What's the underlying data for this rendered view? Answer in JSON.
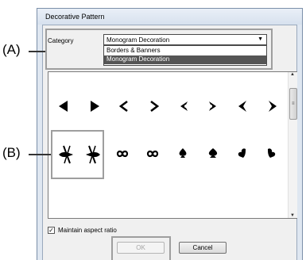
{
  "dialog": {
    "title": "Decorative Pattern",
    "category_label": "Category",
    "category_selected": "Monogram Decoration",
    "category_options": [
      "Borders & Banners",
      "Monogram Decoration"
    ],
    "maintain_aspect_label": "Maintain aspect ratio",
    "maintain_aspect_checked": true,
    "ok_label": "OK",
    "cancel_label": "Cancel"
  },
  "callouts": {
    "a": "(A)",
    "b": "(B)"
  },
  "icons": {
    "dropdown": "chevron-down-icon",
    "scroll_up": "scroll-up-icon",
    "scroll_down": "scroll-down-icon",
    "check": "checkmark-icon"
  },
  "patterns": {
    "row1": [
      "arrow-left-solid",
      "arrow-right-solid",
      "chevron-left",
      "chevron-right",
      "notched-left",
      "notched-right",
      "flared-left",
      "flared-right"
    ],
    "row2": [
      "crossed-bow-left",
      "crossed-bow-right",
      "infinity-left",
      "infinity-right",
      "spade",
      "spade-wide",
      "heart-left",
      "heart-right"
    ]
  },
  "colors": {
    "dialog_border": "#7b8fa9",
    "selection_bg": "#555555",
    "highlight_outline": "#9e9e9e",
    "disabled_text": "#a5a5a5"
  }
}
